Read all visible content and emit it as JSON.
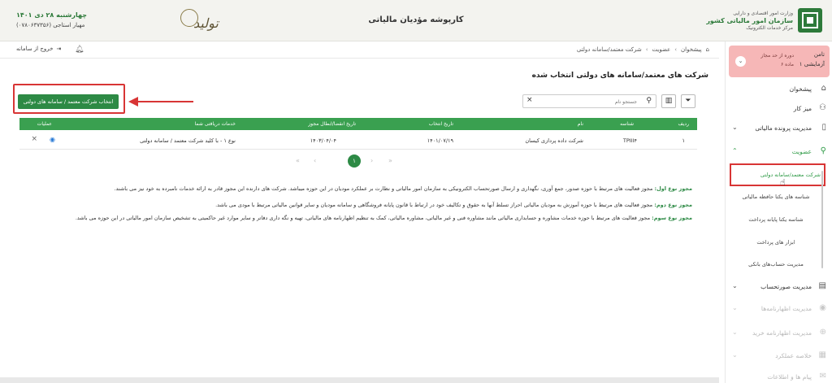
{
  "header": {
    "title": "کارپوشه مؤدیان مالیاتی",
    "date": "چهارشنبه ۲۸ دی ۱۴۰۱",
    "user": "مهیار استاجی (۰۷۸۰۶۳۷۳۵۶)",
    "product_logo": "تولید",
    "org_line1": "وزارت امور اقتصادی و دارایی",
    "org_line2": "سازمان امور مالیاتی کشور",
    "org_line3": "مرکز خدمات الکترونیک"
  },
  "subbar": {
    "crumbs": [
      "پیشخوان",
      "عضویت",
      "شرکت معتمد/سامانه دولتی"
    ],
    "logout_label": "خروج از سامانه"
  },
  "profile": {
    "name_line1": "تامن",
    "name_line2": "آزمایشی ۱",
    "term_line1": "دوره از حد مجاز",
    "term_line2": "ماده ۶"
  },
  "sidebar": {
    "items": [
      {
        "label": "پیشخوان",
        "icon": "home-icon"
      },
      {
        "label": "میز کار",
        "icon": "workspace-icon"
      },
      {
        "label": "مدیریت پرونده مالیاتی",
        "icon": "file-icon"
      },
      {
        "label": "عضویت",
        "icon": "user-icon"
      },
      {
        "label": "مدیریت صورتحساب",
        "icon": "invoice-icon"
      },
      {
        "label": "مدیریت اظهارنامه‌ها",
        "icon": "eye-icon"
      },
      {
        "label": "مدیریت اظهارنامه خرید",
        "icon": "cart-icon"
      },
      {
        "label": "خلاصه عملکرد",
        "icon": "chart-icon"
      },
      {
        "label": "پیام ها و اطلاعات",
        "icon": "message-icon"
      }
    ],
    "sub_items": [
      "شرکت معتمد/سامانه دولتی",
      "شناسه های یکتا حافظه مالیاتی",
      "شناسه یکتا پایانه پرداخت",
      "ابزار های پرداخت",
      "مدیریت حساب‌های بانکی"
    ]
  },
  "main": {
    "title": "شرکت های معتمد/سامانه های دولتی انتخاب شده",
    "select_button": "انتخاب شرکت معتمد / سامانه های دولتی",
    "search_placeholder": "جستجو نام"
  },
  "table": {
    "headers": [
      "ردیف",
      "شناسه",
      "نام",
      "تاریخ انتخاب",
      "تاریخ انقضا/ابطال مجوز",
      "خدمات دریافتی شما",
      "عملیات"
    ],
    "rows": [
      {
        "index": "۱",
        "id": "TPIII۴",
        "name": "شرکت داده پردازی کیسان",
        "select_date": "۱۴۰۱/۰۷/۱۹",
        "expiry_date": "۱۴۰۳/۰۴/۰۴",
        "services": "نوع ۱ - با کلید شرکت معتمد / سامانه دولتی"
      }
    ]
  },
  "pager": {
    "current": "۱"
  },
  "notes": [
    {
      "title": "مجوز نوع اول:",
      "text": "مجوز فعالیت های مرتبط با حوزه صدور، جمع آوری، نگهداری و ارسال صورتحساب الکترونیکی به سازمان امور مالیاتی و نظارت بر عملکرد مودیان در این حوزه میباشد. شرکت های دارنده این مجوز قادر به ارائه خدمات نامبرده به خود نیز می باشند."
    },
    {
      "title": "مجوز نوع دوم:",
      "text": "مجوز فعالیت های مرتبط با حوزه آموزش به مودیان مالیاتی احراز تسلط آنها به حقوق و تکالیف خود در ارتباط با قانون پایانه فروشگاهی و سامانه مودیان و سایر قوانین مالیاتی مرتبط با مودی می باشد."
    },
    {
      "title": "مجوز نوع سوم:",
      "text": "مجوز فعالیت های مرتبط با حوزه خدمات مشاوره و حسابداری مالیاتی مانند مشاوره فنی و غیر مالیاتی، مشاوره مالیاتی، کمک به تنظیم اظهارنامه های مالیاتی، تهیه و نگه داری دفاتر و سایر موارد غیر حاکمیتی به تشخیص سازمان امور مالیاتی در این حوزه می باشد."
    }
  ],
  "colors": {
    "brand_green": "#2d8a45",
    "highlight_red": "#d83535",
    "profile_bg": "#f6b7b7"
  }
}
